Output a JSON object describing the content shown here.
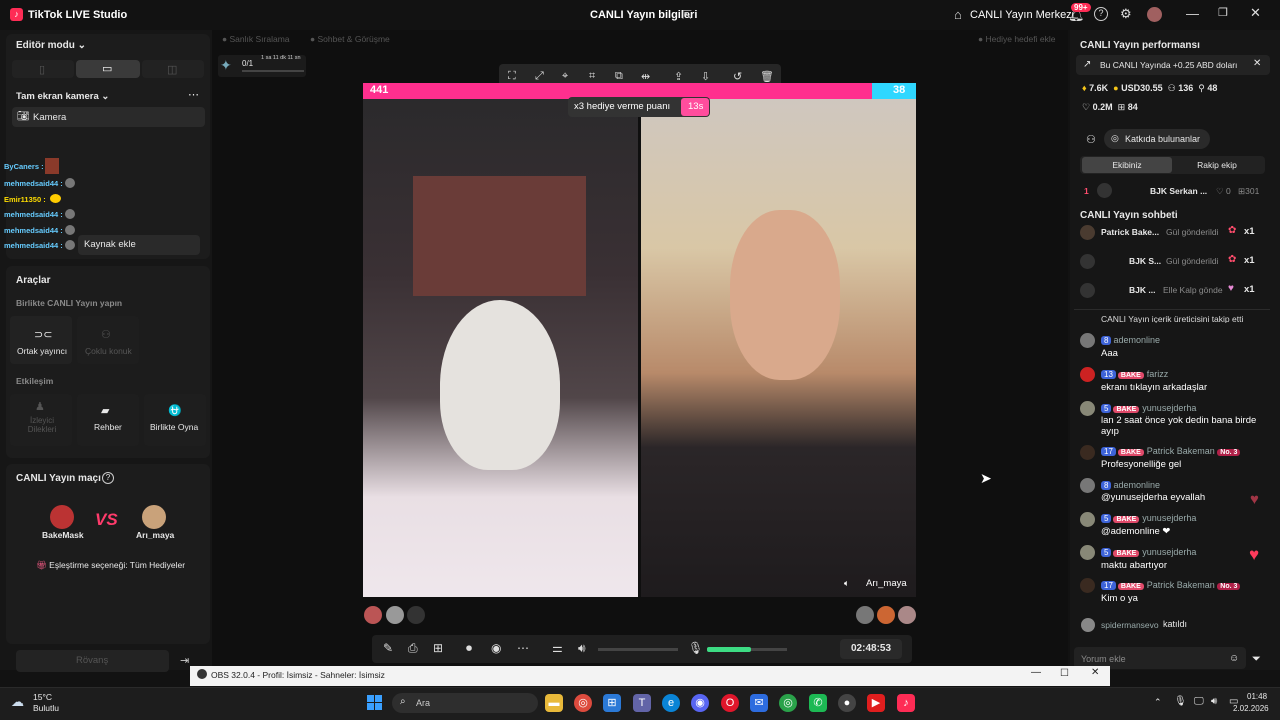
{
  "titlebar": {
    "app": "TikTok LIVE Studio",
    "center_title": "CANLI Yayın bilgileri",
    "live_center": "CANLI Yayın Merkezi",
    "notif_badge": "99+"
  },
  "left": {
    "editor_mode": "Editör modu",
    "fullscreen_camera": "Tam ekran kamera",
    "camera_label": "Kamera",
    "add_source": "Kaynak ekle",
    "overlay_users": [
      "ByCaners :",
      "mehmedsaid44 :",
      "Emir11350 :",
      "mehmedsaid44 :",
      "mehmedsaid44 :",
      "mehmedsaid44 :"
    ],
    "tools_title": "Araçlar",
    "live_together": "Birlikte CANLI Yayın yapın",
    "co_host": "Ortak yayıncı",
    "multi_guest": "Çoklu konuk",
    "interaction": "Etkileşim",
    "viewer_wishes": "İzleyici Dilekleri",
    "guide": "Rehber",
    "play_together": "Birlikte Oyna",
    "match_title": "CANLI Yayın maçı",
    "player1": "BakeMask",
    "player2": "Arı_maya",
    "vs": "VS",
    "matching_option": "Eşleştirme seçeneği: Tüm Hediyeler",
    "rematch": "Rövanş"
  },
  "center": {
    "tabs_faint": [
      "Sanlık Sıralama",
      "Sohbet & Görüşme",
      "Hediye hedefi ekle"
    ],
    "counter": "0/1",
    "counter_time": "1 sa 11 dk 11 sn",
    "score_left": "441",
    "score_right": "38",
    "gift_banner": "x3 hediye verme puanı",
    "gift_timer": "13s",
    "right_name": "Arı_maya",
    "timer": "02:48:53",
    "volume_level": 0.55
  },
  "right": {
    "perf_title": "CANLI Yayın performansı",
    "promo": "Bu CANLI Yayında +0.25 ABD doları",
    "stats": {
      "diamonds": "7.6K",
      "usd": "USD30.55",
      "viewers": "136",
      "followers": "48",
      "likes": "0.2M",
      "gifts": "84"
    },
    "contributors": "Katkıda bulunanlar",
    "tab_team": "Ekibiniz",
    "tab_rival": "Rakip ekip",
    "rank_row": {
      "rank": "1",
      "name": "BJK Serkan ...",
      "hearts": "0",
      "gifts": "301"
    },
    "chat_title": "CANLI Yayın sohbeti",
    "gift_rows": [
      {
        "name": "Patrick Bake...",
        "action": "Gül gönderildi",
        "count": "x1"
      },
      {
        "name": "BJK S...",
        "action": "Gül gönderildi",
        "count": "x1"
      },
      {
        "name": "BJK ...",
        "action": "Elle Kalp gönde",
        "count": "x1"
      }
    ],
    "chat_cut": "CANLI Yayın içerik üreticisini takip etti",
    "chat": [
      {
        "level": "8",
        "badge": "",
        "name": "ademonline",
        "msg": "Aaa"
      },
      {
        "level": "13",
        "badge": "BAKE",
        "name": "farizz",
        "msg": "ekranı tıklayın arkadaşlar"
      },
      {
        "level": "5",
        "badge": "BAKE",
        "name": "yunusejderha",
        "msg": "lan 2 saat önce yok dedin bana birde ayıp"
      },
      {
        "level": "17",
        "badge": "BAKE",
        "name": "Patrick Bakeman",
        "rank": "No. 3",
        "msg": "Profesyonelliğe gel"
      },
      {
        "level": "8",
        "badge": "",
        "name": "ademonline",
        "msg": "@yunusejderha eyvallah"
      },
      {
        "level": "5",
        "badge": "BAKE",
        "name": "yunusejderha",
        "msg": "@ademonline ❤"
      },
      {
        "level": "5",
        "badge": "BAKE",
        "name": "yunusejderha",
        "msg": "maktu abartıyor"
      },
      {
        "level": "17",
        "badge": "BAKE",
        "name": "Patrick Bakeman",
        "rank": "No. 3",
        "msg": "Kim o ya"
      }
    ],
    "joined_name": "spidermansevo",
    "joined": "katıldı",
    "comment_placeholder": "Yorum ekle"
  },
  "obs_bar": {
    "title": "OBS 32.0.4 - Profil: İsimsiz - Sahneler: İsimsiz"
  },
  "taskbar": {
    "temp": "15°C",
    "weather": "Bulutlu",
    "search": "Ara",
    "time": "01:48",
    "date": "2.02.2026"
  }
}
